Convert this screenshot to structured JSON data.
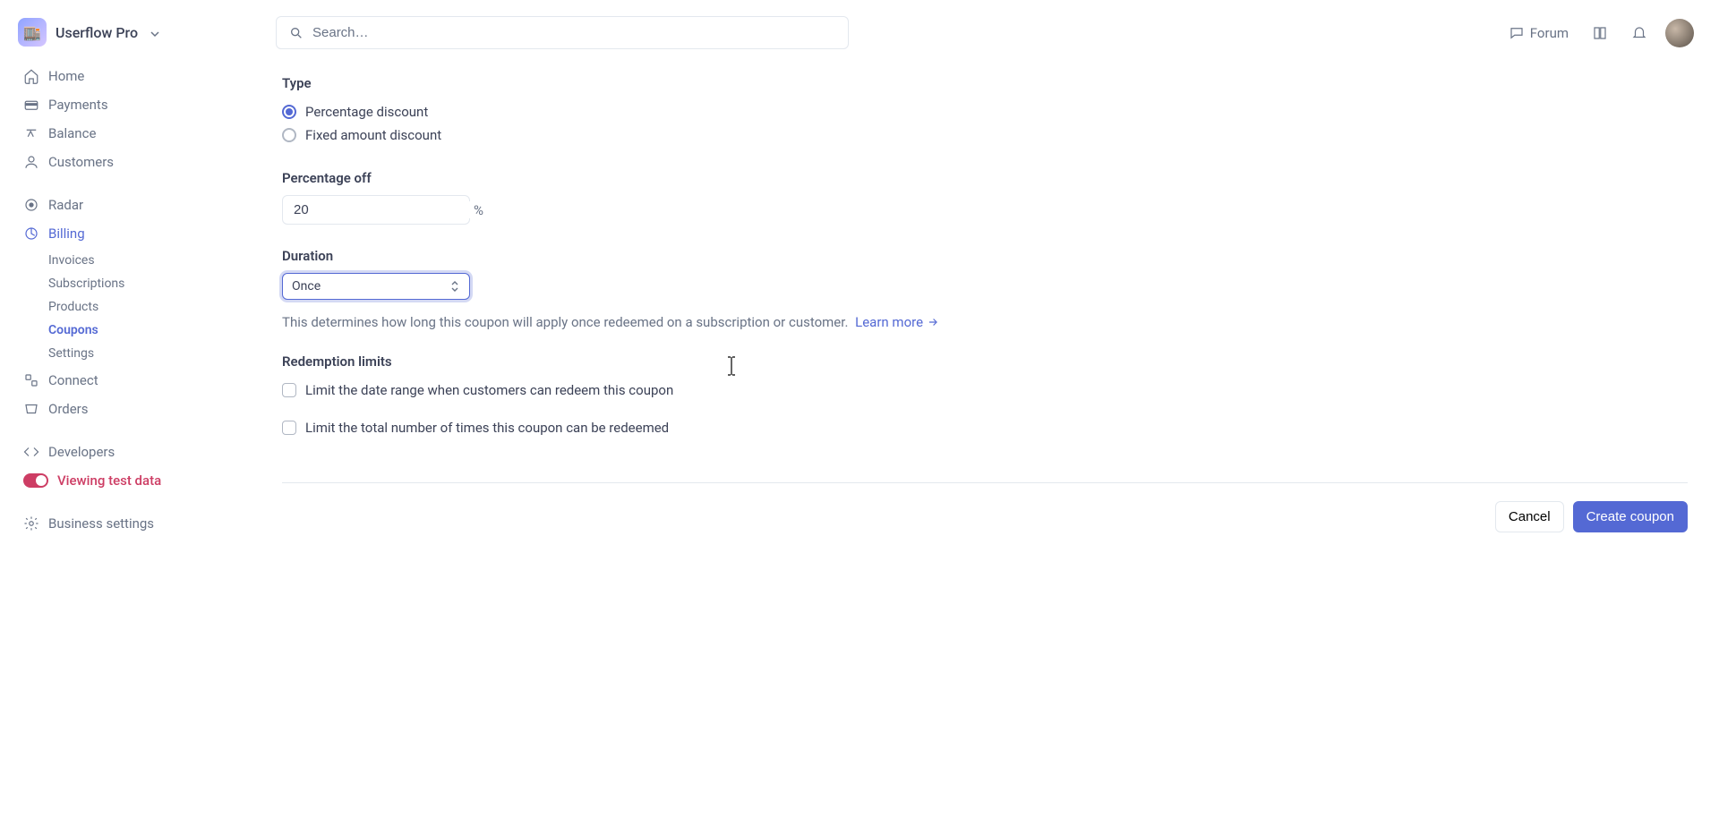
{
  "topbar": {
    "org_name": "Userflow Pro",
    "search_placeholder": "Search…",
    "forum_label": "Forum"
  },
  "sidebar": {
    "primary": [
      {
        "label": "Home",
        "icon": "home"
      },
      {
        "label": "Payments",
        "icon": "payments"
      },
      {
        "label": "Balance",
        "icon": "balance"
      },
      {
        "label": "Customers",
        "icon": "customers"
      }
    ],
    "radar_label": "Radar",
    "billing": {
      "label": "Billing",
      "children": [
        {
          "label": "Invoices",
          "active": false
        },
        {
          "label": "Subscriptions",
          "active": false
        },
        {
          "label": "Products",
          "active": false
        },
        {
          "label": "Coupons",
          "active": true
        },
        {
          "label": "Settings",
          "active": false
        }
      ]
    },
    "connect_label": "Connect",
    "orders_label": "Orders",
    "developers_label": "Developers",
    "test_data_label": "Viewing test data",
    "business_settings_label": "Business settings"
  },
  "form": {
    "type_label": "Type",
    "type_options": {
      "percentage": "Percentage discount",
      "fixed": "Fixed amount discount"
    },
    "type_selected": "percentage",
    "percent_off_label": "Percentage off",
    "percent_off_value": "20",
    "percent_off_suffix": "%",
    "duration_label": "Duration",
    "duration_value": "Once",
    "duration_helper": "This determines how long this coupon will apply once redeemed on a subscription or customer.",
    "learn_more_label": "Learn more",
    "redemption_limits_label": "Redemption limits",
    "limit_date_label": "Limit the date range when customers can redeem this coupon",
    "limit_total_label": "Limit the total number of times this coupon can be redeemed"
  },
  "footer": {
    "cancel_label": "Cancel",
    "create_label": "Create coupon"
  }
}
